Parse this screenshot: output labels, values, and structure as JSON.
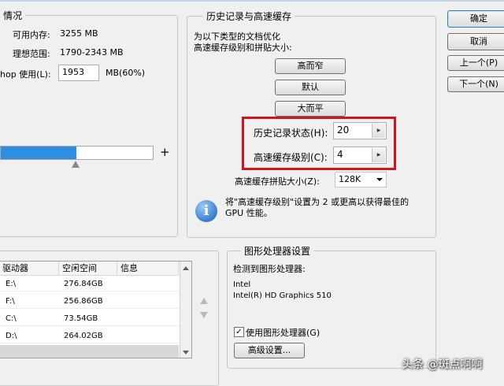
{
  "memory": {
    "group_title": "情况",
    "available_label": "可用内存:",
    "available_value": "3255 MB",
    "ideal_label": "理想范围:",
    "ideal_value": "1790-2343 MB",
    "usage_label": "hop 使用(L):",
    "usage_value": "1953",
    "usage_unit": "MB(60%)",
    "slider_plus": "+",
    "slider_level_percent": 60
  },
  "history_cache": {
    "group_title": "历史记录与高速缓存",
    "description_line1": "为以下类型的文档优化",
    "description_line2": "高速缓存级别和拼贴大小:",
    "btn_tall_thin": "高而窄",
    "btn_default": "默认",
    "btn_big_flat": "大而平",
    "history_states_label": "历史记录状态(H):",
    "history_states_value": "20",
    "cache_levels_label": "高速缓存级别(C):",
    "cache_levels_value": "4",
    "tile_size_label": "高速缓存拼贴大小(Z):",
    "tile_size_value": "128K",
    "info_line1": "将\"高速缓存级别\"设置为 2 或更高以获得最佳的",
    "info_line2": "GPU 性能。"
  },
  "dialog_buttons": {
    "ok": "确定",
    "cancel": "取消",
    "prev": "上一个(P)",
    "next": "下一个(N)"
  },
  "scratch": {
    "columns": [
      "驱动器",
      "空闲空间",
      "信息"
    ],
    "rows": [
      {
        "drive": "E:\\",
        "free": "276.84GB",
        "info": ""
      },
      {
        "drive": "F:\\",
        "free": "256.86GB",
        "info": ""
      },
      {
        "drive": "C:\\",
        "free": "73.54GB",
        "info": ""
      },
      {
        "drive": "D:\\",
        "free": "264.02GB",
        "info": ""
      }
    ]
  },
  "gpu": {
    "group_title": "图形处理器设置",
    "detected_label": "检测到图形处理器:",
    "vendor": "Intel",
    "model": "Intel(R) HD Graphics 510",
    "use_gpu_label": "使用图形处理器(G)",
    "use_gpu_checked": true,
    "advanced_button": "高级设置..."
  },
  "watermark": "头条 @斑点啊啊",
  "colors": {
    "highlight_box": "#d0161c",
    "slider_fill": "#2f8ee0",
    "info_icon": "#3a7fd0"
  }
}
